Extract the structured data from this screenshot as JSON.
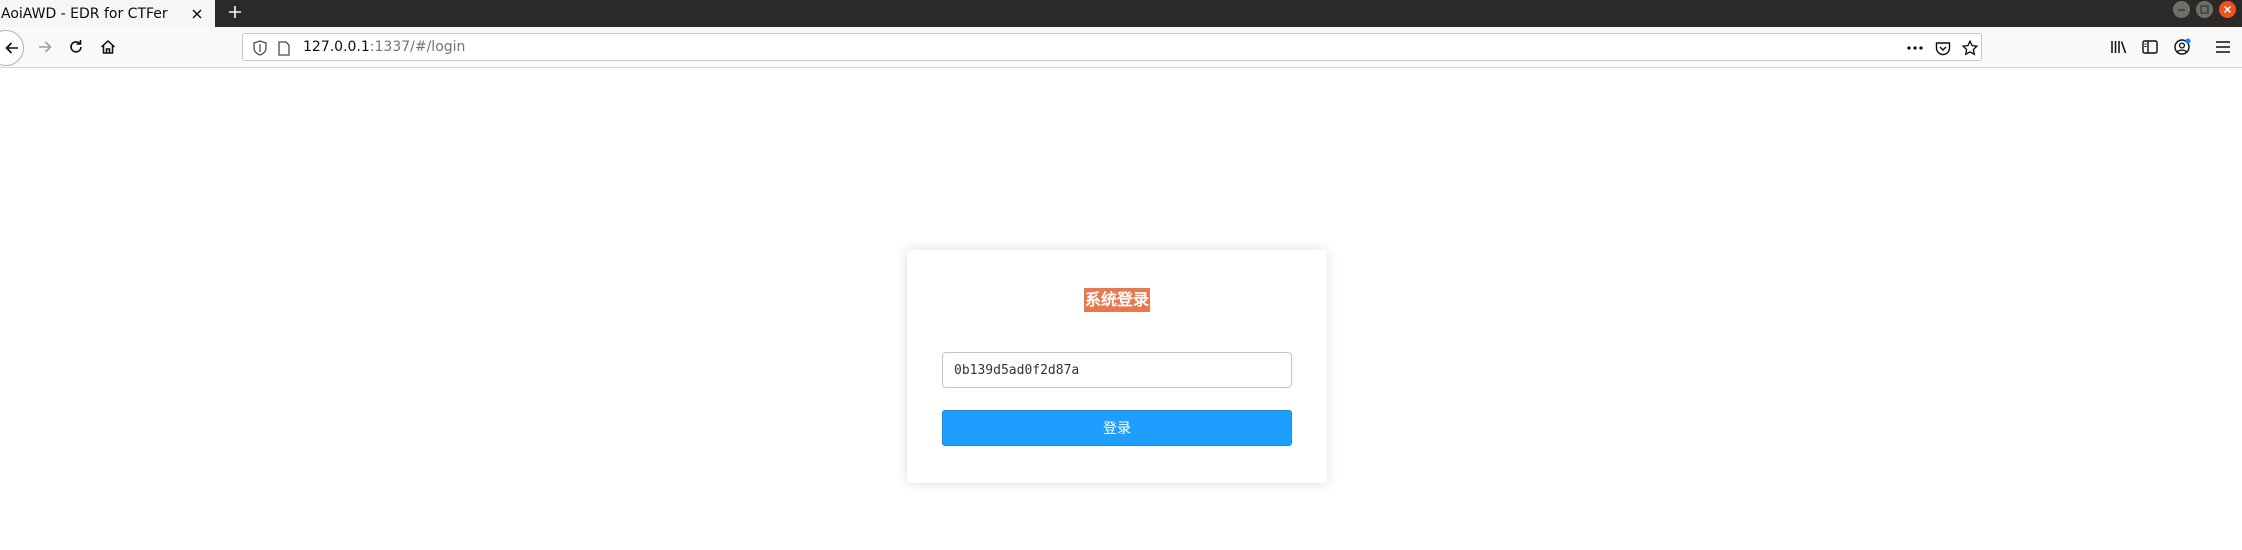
{
  "browser": {
    "tab": {
      "title": "AoiAWD - EDR for CTFer",
      "close_icon": "close-icon"
    },
    "new_tab_icon": "plus-icon",
    "url": {
      "host": "127.0.0.1",
      "rest": ":1337/#/login"
    },
    "nav_icons": [
      "back-arrow-icon",
      "forward-arrow-icon",
      "reload-icon",
      "home-icon"
    ],
    "url_icons": [
      "tracking-shield-icon",
      "page-icon",
      "more-dots-icon",
      "pocket-icon",
      "bookmark-star-icon"
    ],
    "toolbar_icons": [
      "library-icon",
      "sidebar-icon",
      "account-icon",
      "hamburger-menu-icon"
    ],
    "window_controls": [
      "minimize",
      "maximize",
      "close"
    ],
    "colors": {
      "tabstrip": "#2b2a29",
      "close_control": "#e95420"
    }
  },
  "login": {
    "title": "系统登录",
    "token_value": "0b139d5ad0f2d87a",
    "submit_label": "登录",
    "colors": {
      "title_bg": "#e8784d",
      "button_bg": "#1e9fff"
    }
  }
}
